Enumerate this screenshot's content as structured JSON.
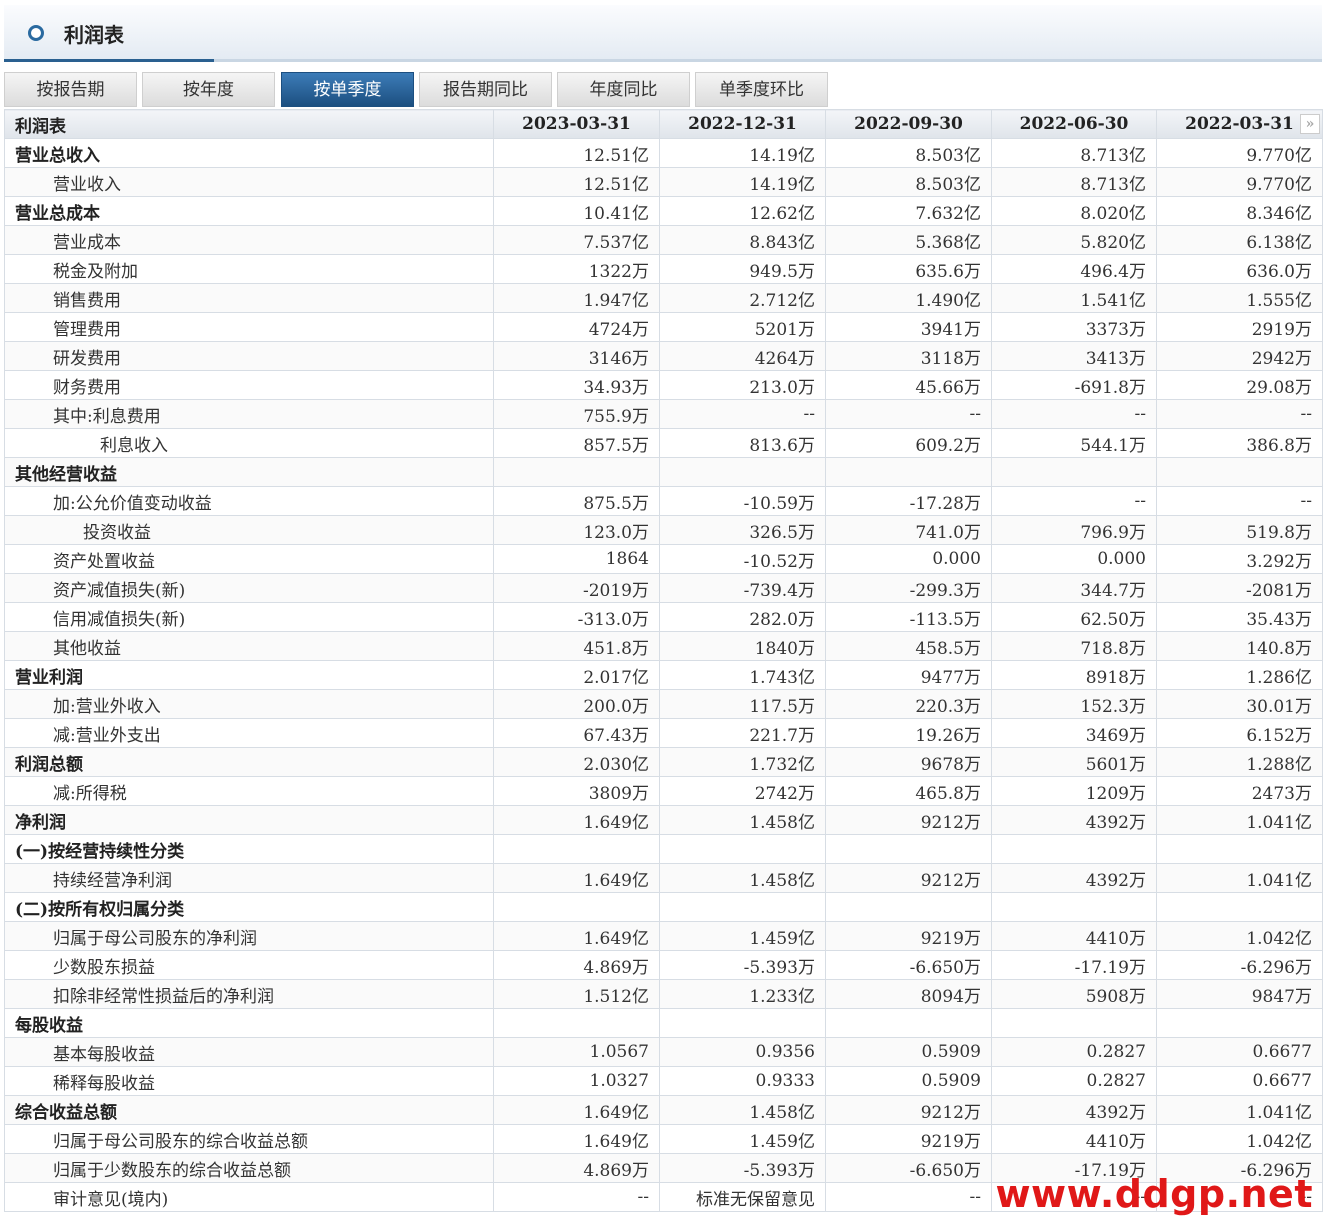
{
  "title": "利润表",
  "tabs": [
    "按报告期",
    "按年度",
    "按单季度",
    "报告期同比",
    "年度同比",
    "单季度环比"
  ],
  "active_tab_index": 2,
  "table": {
    "header_label": "利润表",
    "columns": [
      "2023-03-31",
      "2022-12-31",
      "2022-09-30",
      "2022-06-30",
      "2022-03-31"
    ],
    "next_icon": "double-chevron-right-icon",
    "rows": [
      {
        "label": "营业总收入",
        "level": 0,
        "bold": true,
        "values": [
          "12.51亿",
          "14.19亿",
          "8.503亿",
          "8.713亿",
          "9.770亿"
        ]
      },
      {
        "label": "营业收入",
        "level": 1,
        "bold": false,
        "values": [
          "12.51亿",
          "14.19亿",
          "8.503亿",
          "8.713亿",
          "9.770亿"
        ]
      },
      {
        "label": "营业总成本",
        "level": 0,
        "bold": true,
        "values": [
          "10.41亿",
          "12.62亿",
          "7.632亿",
          "8.020亿",
          "8.346亿"
        ]
      },
      {
        "label": "营业成本",
        "level": 1,
        "bold": false,
        "values": [
          "7.537亿",
          "8.843亿",
          "5.368亿",
          "5.820亿",
          "6.138亿"
        ]
      },
      {
        "label": "税金及附加",
        "level": 1,
        "bold": false,
        "values": [
          "1322万",
          "949.5万",
          "635.6万",
          "496.4万",
          "636.0万"
        ]
      },
      {
        "label": "销售费用",
        "level": 1,
        "bold": false,
        "values": [
          "1.947亿",
          "2.712亿",
          "1.490亿",
          "1.541亿",
          "1.555亿"
        ]
      },
      {
        "label": "管理费用",
        "level": 1,
        "bold": false,
        "values": [
          "4724万",
          "5201万",
          "3941万",
          "3373万",
          "2919万"
        ]
      },
      {
        "label": "研发费用",
        "level": 1,
        "bold": false,
        "values": [
          "3146万",
          "4264万",
          "3118万",
          "3413万",
          "2942万"
        ]
      },
      {
        "label": "财务费用",
        "level": 1,
        "bold": false,
        "values": [
          "34.93万",
          "213.0万",
          "45.66万",
          "-691.8万",
          "29.08万"
        ]
      },
      {
        "label": "其中:利息费用",
        "level": 1,
        "bold": false,
        "values": [
          "755.9万",
          "--",
          "--",
          "--",
          "--"
        ]
      },
      {
        "label": "利息收入",
        "level": 3,
        "bold": false,
        "values": [
          "857.5万",
          "813.6万",
          "609.2万",
          "544.1万",
          "386.8万"
        ]
      },
      {
        "label": "其他经营收益",
        "level": 0,
        "bold": true,
        "values": [
          "",
          "",
          "",
          "",
          ""
        ]
      },
      {
        "label": "加:公允价值变动收益",
        "level": 1,
        "bold": false,
        "values": [
          "875.5万",
          "-10.59万",
          "-17.28万",
          "--",
          "--"
        ]
      },
      {
        "label": "投资收益",
        "level": 2,
        "bold": false,
        "values": [
          "123.0万",
          "326.5万",
          "741.0万",
          "796.9万",
          "519.8万"
        ]
      },
      {
        "label": "资产处置收益",
        "level": 1,
        "bold": false,
        "values": [
          "1864",
          "-10.52万",
          "0.000",
          "0.000",
          "3.292万"
        ]
      },
      {
        "label": "资产减值损失(新)",
        "level": 1,
        "bold": false,
        "values": [
          "-2019万",
          "-739.4万",
          "-299.3万",
          "344.7万",
          "-2081万"
        ]
      },
      {
        "label": "信用减值损失(新)",
        "level": 1,
        "bold": false,
        "values": [
          "-313.0万",
          "282.0万",
          "-113.5万",
          "62.50万",
          "35.43万"
        ]
      },
      {
        "label": "其他收益",
        "level": 1,
        "bold": false,
        "values": [
          "451.8万",
          "1840万",
          "458.5万",
          "718.8万",
          "140.8万"
        ]
      },
      {
        "label": "营业利润",
        "level": 0,
        "bold": true,
        "values": [
          "2.017亿",
          "1.743亿",
          "9477万",
          "8918万",
          "1.286亿"
        ]
      },
      {
        "label": "加:营业外收入",
        "level": 1,
        "bold": false,
        "values": [
          "200.0万",
          "117.5万",
          "220.3万",
          "152.3万",
          "30.01万"
        ]
      },
      {
        "label": "减:营业外支出",
        "level": 1,
        "bold": false,
        "values": [
          "67.43万",
          "221.7万",
          "19.26万",
          "3469万",
          "6.152万"
        ]
      },
      {
        "label": "利润总额",
        "level": 0,
        "bold": true,
        "values": [
          "2.030亿",
          "1.732亿",
          "9678万",
          "5601万",
          "1.288亿"
        ]
      },
      {
        "label": "减:所得税",
        "level": 1,
        "bold": false,
        "values": [
          "3809万",
          "2742万",
          "465.8万",
          "1209万",
          "2473万"
        ]
      },
      {
        "label": "净利润",
        "level": 0,
        "bold": true,
        "values": [
          "1.649亿",
          "1.458亿",
          "9212万",
          "4392万",
          "1.041亿"
        ]
      },
      {
        "label": "(一)按经营持续性分类",
        "level": 0,
        "bold": true,
        "values": [
          "",
          "",
          "",
          "",
          ""
        ]
      },
      {
        "label": "持续经营净利润",
        "level": 1,
        "bold": false,
        "values": [
          "1.649亿",
          "1.458亿",
          "9212万",
          "4392万",
          "1.041亿"
        ]
      },
      {
        "label": "(二)按所有权归属分类",
        "level": 0,
        "bold": true,
        "values": [
          "",
          "",
          "",
          "",
          ""
        ]
      },
      {
        "label": "归属于母公司股东的净利润",
        "level": 1,
        "bold": false,
        "values": [
          "1.649亿",
          "1.459亿",
          "9219万",
          "4410万",
          "1.042亿"
        ]
      },
      {
        "label": "少数股东损益",
        "level": 1,
        "bold": false,
        "values": [
          "4.869万",
          "-5.393万",
          "-6.650万",
          "-17.19万",
          "-6.296万"
        ]
      },
      {
        "label": "扣除非经常性损益后的净利润",
        "level": 1,
        "bold": false,
        "values": [
          "1.512亿",
          "1.233亿",
          "8094万",
          "5908万",
          "9847万"
        ]
      },
      {
        "label": "每股收益",
        "level": 0,
        "bold": true,
        "values": [
          "",
          "",
          "",
          "",
          ""
        ]
      },
      {
        "label": "基本每股收益",
        "level": 1,
        "bold": false,
        "values": [
          "1.0567",
          "0.9356",
          "0.5909",
          "0.2827",
          "0.6677"
        ]
      },
      {
        "label": "稀释每股收益",
        "level": 1,
        "bold": false,
        "values": [
          "1.0327",
          "0.9333",
          "0.5909",
          "0.2827",
          "0.6677"
        ]
      },
      {
        "label": "综合收益总额",
        "level": 0,
        "bold": true,
        "values": [
          "1.649亿",
          "1.458亿",
          "9212万",
          "4392万",
          "1.041亿"
        ]
      },
      {
        "label": "归属于母公司股东的综合收益总额",
        "level": 1,
        "bold": false,
        "values": [
          "1.649亿",
          "1.459亿",
          "9219万",
          "4410万",
          "1.042亿"
        ]
      },
      {
        "label": "归属于少数股东的综合收益总额",
        "level": 1,
        "bold": false,
        "values": [
          "4.869万",
          "-5.393万",
          "-6.650万",
          "-17.19万",
          "-6.296万"
        ]
      },
      {
        "label": "审计意见(境内)",
        "level": 1,
        "bold": false,
        "values": [
          "--",
          "标准无保留意见",
          "--",
          "--",
          "--"
        ]
      }
    ]
  },
  "watermark": "www.ddgp.net"
}
